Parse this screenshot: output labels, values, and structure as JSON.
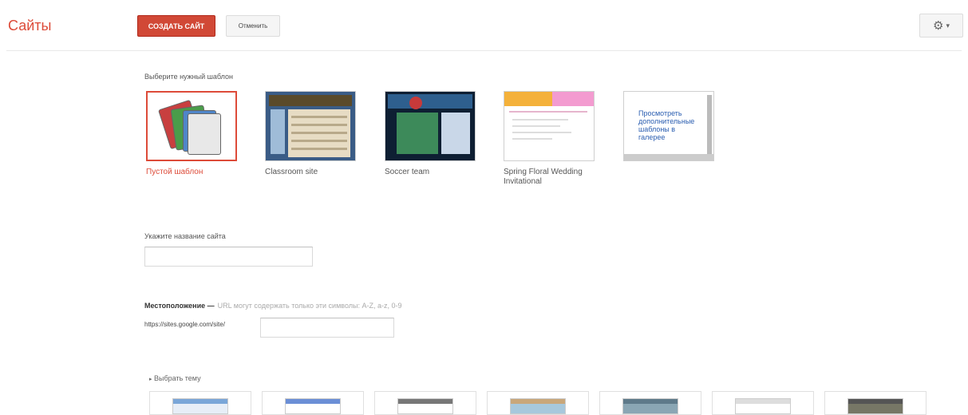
{
  "header": {
    "app_title": "Сайты",
    "create_button": "СОЗДАТЬ САЙТ",
    "cancel_button": "Отменить",
    "settings_icon": "gear-icon",
    "settings_caret": "▾"
  },
  "template_section": {
    "label": "Выберите нужный шаблон",
    "templates": [
      {
        "name": "Пустой шаблон",
        "selected": true
      },
      {
        "name": "Classroom site",
        "selected": false
      },
      {
        "name": "Soccer team",
        "selected": false
      },
      {
        "name": "Spring Floral Wedding Invitational",
        "selected": false
      }
    ],
    "more_templates": "Просмотреть дополнительные шаблоны в галерее"
  },
  "site_name": {
    "label": "Укажите название сайта",
    "value": ""
  },
  "location": {
    "label": "Местоположение —",
    "hint": "URL могут содержать только эти символы: A-Z, a-z, 0-9",
    "url_prefix": "https://sites.google.com/site/",
    "value": ""
  },
  "theme": {
    "toggle_label": "Выбрать тему",
    "toggle_icon": "triangle-right-icon",
    "themes": [
      {
        "accent": "#7aa6d8",
        "frame": "#e7eef7"
      },
      {
        "accent": "#6b8fd6",
        "frame": "#ffffff"
      },
      {
        "accent": "#777777",
        "frame": "#ffffff"
      },
      {
        "accent": "#c9a77a",
        "frame": "#a7c8dc"
      },
      {
        "accent": "#5e7a8a",
        "frame": "#8aa6b4"
      },
      {
        "accent": "#dddddd",
        "frame": "#ffffff"
      },
      {
        "accent": "#555555",
        "frame": "#777766"
      }
    ]
  },
  "colors": {
    "brand_red": "#dd4b39",
    "link_blue": "#2a5db0"
  }
}
